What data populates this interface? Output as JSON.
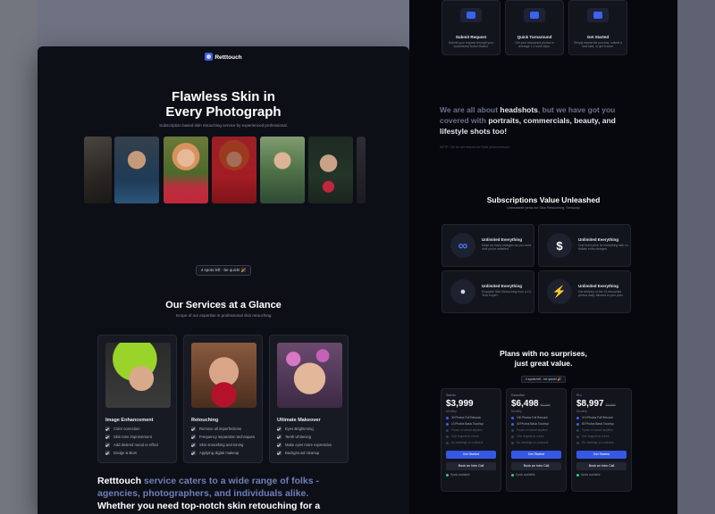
{
  "brand": {
    "name": "Retttouch"
  },
  "hero": {
    "title_line1": "Flawless Skin in",
    "title_line2": "Every Photograph",
    "subtitle": "Subscription based skin retouching service by experienced professional.",
    "spots_badge": "4 spots left - be quick! 🎉"
  },
  "services": {
    "title": "Our Services at a Glance",
    "subtitle": "Scope of our expertise in professional skin retouching",
    "cards": [
      {
        "name": "Image Enhancement",
        "features": [
          "Color correction",
          "Skin tone improvement",
          "Add desired mood or effect",
          "Dodge & Burn"
        ]
      },
      {
        "name": "Retouching",
        "features": [
          "Remove all imperfections",
          "Frequency separation techniques",
          "Skin smoothing and toning",
          "Applying digital makeup"
        ]
      },
      {
        "name": "Ultimate Makeover",
        "features": [
          "Eyes Brightening",
          "Teeth whitening",
          "Make eyes more expressive",
          "Background cleanup"
        ]
      }
    ]
  },
  "bottom_text": {
    "brand": "Retttouch",
    "part1": " service caters to a wide range of folks - agencies, photographers, and individuals ",
    "alike": "alike.",
    "part2": " Whether you need top-notch skin retouching for a"
  },
  "steps": [
    {
      "title": "Submit Request",
      "desc": "Submit your request through your customized Notion Board."
    },
    {
      "title": "Quick Turnaround",
      "desc": "Get your retouched photos in average 1-2 work days."
    },
    {
      "title": "Get Started",
      "desc": "Simply repeat the process, submit a new task, or get it done."
    }
  ],
  "about": {
    "pre": "We are all about ",
    "headshots": "headshots",
    "mid": ", but we have got you covered with ",
    "list": "portraits, commercials, beauty, and lifestyle shots too!",
    "note": "NOTE: We do not retouch for RAW photos/retouch"
  },
  "subscriptions": {
    "title": "Subscriptions Value Unleashed",
    "subtitle": "Unbeatable perks for Skin Retouching, Seriously",
    "perks": [
      {
        "icon": "infinity-icon",
        "title": "Unlimited Everything",
        "desc": "Make as many changes as you need until you're satisfied."
      },
      {
        "icon": "dollar-badge-icon",
        "title": "Unlimited Everything",
        "desc": "One fixed price for everything with no hidden extra charges."
      },
      {
        "icon": "person-icon",
        "title": "Unlimited Everything",
        "desc": "Exquisite Skin Retouching from a 10-Year Expert."
      },
      {
        "icon": "lightning-icon",
        "title": "Unlimited Everything",
        "desc": "Get delivery of the 24 retouched photos daily, tailored to your plan."
      }
    ]
  },
  "plans": {
    "title_line1": "Plans with no surprises,",
    "title_line2": "just great value.",
    "badge": "4 spots left - be quick! 🎉",
    "cards": [
      {
        "name": "Starter",
        "price": "$3,999",
        "old_price": "",
        "period": "Monthly",
        "features": [
          [
            "30 Photos Full Retouch",
            true
          ],
          [
            "10 Photos Basic Touchup",
            true
          ],
          [
            "Pause or cancel anytime",
            false
          ],
          [
            "One request at a time",
            false
          ],
          [
            "No meetings or contracts",
            false
          ]
        ],
        "primary": "Get Started",
        "secondary": "Book an Intro Call",
        "spots": "Spots available"
      },
      {
        "name": "Essential",
        "price": "$6,498",
        "old_price": "$7,000",
        "period": "Monthly",
        "features": [
          [
            "100 Photos Full Retouch",
            true
          ],
          [
            "40 Photos Basic Touchup",
            true
          ],
          [
            "Pause or cancel anytime",
            false
          ],
          [
            "One request at a time",
            false
          ],
          [
            "No meetings or contracts",
            false
          ]
        ],
        "primary": "Get Started",
        "secondary": "Book an Intro Call",
        "spots": "Spots available"
      },
      {
        "name": "Pro",
        "price": "$8,997",
        "old_price": "$9,999",
        "period": "Monthly",
        "features": [
          [
            "4+0 Photos Full Retouch",
            true
          ],
          [
            "80 Photos Basic Touchup",
            true
          ],
          [
            "Pause or cancel anytime",
            false
          ],
          [
            "One request at a time",
            false
          ],
          [
            "No meetings or contracts",
            false
          ]
        ],
        "primary": "Get Started",
        "secondary": "Book an Intro Call",
        "spots": "Spots available"
      }
    ]
  },
  "colors": {
    "accent": "#3558e6",
    "page_bg": "#0d0f17",
    "card_bg": "#171a23",
    "surround": "#6e7181"
  }
}
